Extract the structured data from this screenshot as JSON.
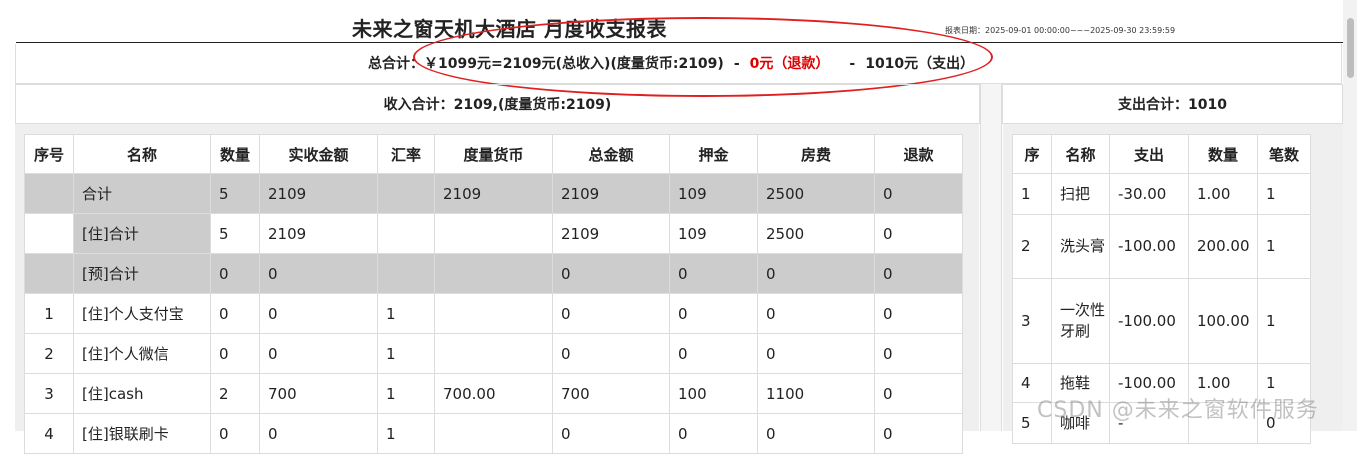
{
  "report": {
    "title": "未来之窗天机大酒店 月度收支报表",
    "date_range": "报表日期：2025-09-01 00:00:00~~~2025-09-30 23:59:59"
  },
  "summary": {
    "label": "总合计：",
    "formula": "￥1099元=2109元(总收入)(度量货币:2109)",
    "minus1": "-",
    "refund": "0元（退款）",
    "minus2": "-",
    "expense": "1010元（支出）"
  },
  "income_total": "收入合计：2109,(度量货币:2109)",
  "expense_total": "支出合计：1010",
  "income_table": {
    "headers": [
      "序号",
      "名称",
      "数量",
      "实收金额",
      "汇率",
      "度量货币",
      "总金额",
      "押金",
      "房费",
      "退款"
    ],
    "rows": [
      [
        "",
        "合计",
        "5",
        "2109",
        "",
        "2109",
        "2109",
        "109",
        "2500",
        "0"
      ],
      [
        "",
        "[住]合计",
        "5",
        "2109",
        "",
        "",
        "2109",
        "109",
        "2500",
        "0"
      ],
      [
        "",
        "[预]合计",
        "0",
        "0",
        "",
        "",
        "0",
        "0",
        "0",
        "0"
      ],
      [
        "1",
        "[住]个人支付宝",
        "0",
        "0",
        "1",
        "",
        "0",
        "0",
        "0",
        "0"
      ],
      [
        "2",
        "[住]个人微信",
        "0",
        "0",
        "1",
        "",
        "0",
        "0",
        "0",
        "0"
      ],
      [
        "3",
        "[住]cash",
        "2",
        "700",
        "1",
        "700.00",
        "700",
        "100",
        "1100",
        "0"
      ],
      [
        "4",
        "[住]银联刷卡",
        "0",
        "0",
        "1",
        "",
        "0",
        "0",
        "0",
        "0"
      ]
    ]
  },
  "expense_table": {
    "headers": [
      "序",
      "名称",
      "支出",
      "数量",
      "笔数"
    ],
    "rows": [
      [
        "1",
        "扫把",
        "-30.00",
        "1.00",
        "1"
      ],
      [
        "2",
        "洗头膏",
        "-100.00",
        "200.00",
        "1"
      ],
      [
        "3",
        "一次性牙刷",
        "-100.00",
        "100.00",
        "1"
      ],
      [
        "4",
        "拖鞋",
        "-100.00",
        "1.00",
        "1"
      ],
      [
        "5",
        "咖啡",
        "-",
        "",
        "0"
      ]
    ]
  },
  "watermark": "CSDN @未来之窗软件服务"
}
